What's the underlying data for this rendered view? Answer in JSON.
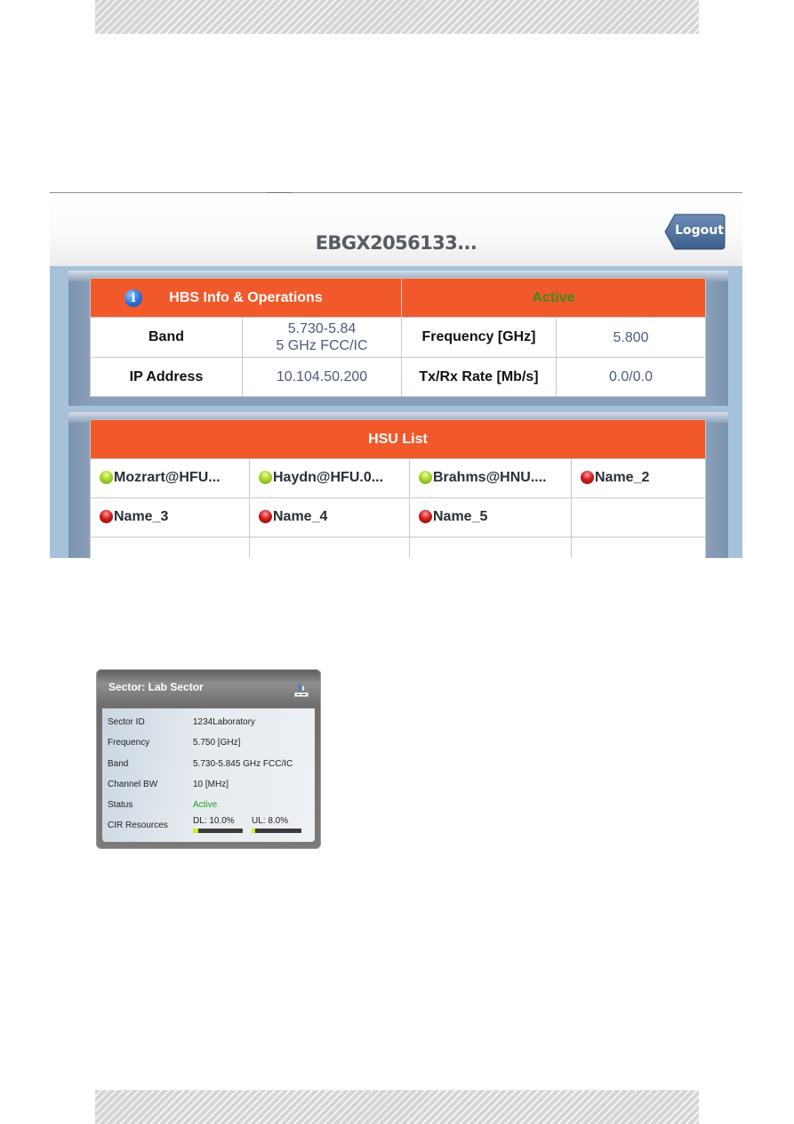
{
  "device_name": "EBGX2056133...",
  "logout_label": "Logout",
  "hbs_panel": {
    "title": "HBS Info & Operations",
    "status": "Active",
    "status_color": "#3c8c1a",
    "header_color": "#f1592b",
    "rows": [
      {
        "label1": "Band",
        "value1_line1": "5.730-5.84",
        "value1_line2": "5 GHz FCC/IC",
        "label2": "Frequency [GHz]",
        "value2": "5.800"
      },
      {
        "label1": "IP Address",
        "value1_line1": "10.104.50.200",
        "value1_line2": "",
        "label2": "Tx/Rx Rate [Mb/s]",
        "value2": "0.0/0.0"
      }
    ]
  },
  "hsu_panel": {
    "title": "HSU List",
    "items": [
      {
        "name": "Mozrart@HFU...",
        "status": "up"
      },
      {
        "name": "Haydn@HFU.0...",
        "status": "up"
      },
      {
        "name": "Brahms@HNU....",
        "status": "up"
      },
      {
        "name": "Name_2",
        "status": "down"
      },
      {
        "name": "Name_3",
        "status": "down"
      },
      {
        "name": "Name_4",
        "status": "down"
      },
      {
        "name": "Name_5",
        "status": "down"
      }
    ]
  },
  "sector_widget": {
    "title": "Sector:  Lab Sector",
    "icon": "network-device-icon",
    "fields": [
      {
        "key": "Sector ID",
        "value": "1234Laboratory"
      },
      {
        "key": "Frequency",
        "value": "5.750 [GHz]"
      },
      {
        "key": "Band",
        "value": "5.730-5.845 GHz FCC/IC"
      },
      {
        "key": "Channel BW",
        "value": "10 [MHz]"
      },
      {
        "key": "Status",
        "value": "Active"
      }
    ],
    "cir": {
      "label": "CIR Resources",
      "dl_label": "DL: 10.0%",
      "dl_percent": 10.0,
      "ul_label": "UL: 8.0%",
      "ul_percent": 8.0
    }
  }
}
